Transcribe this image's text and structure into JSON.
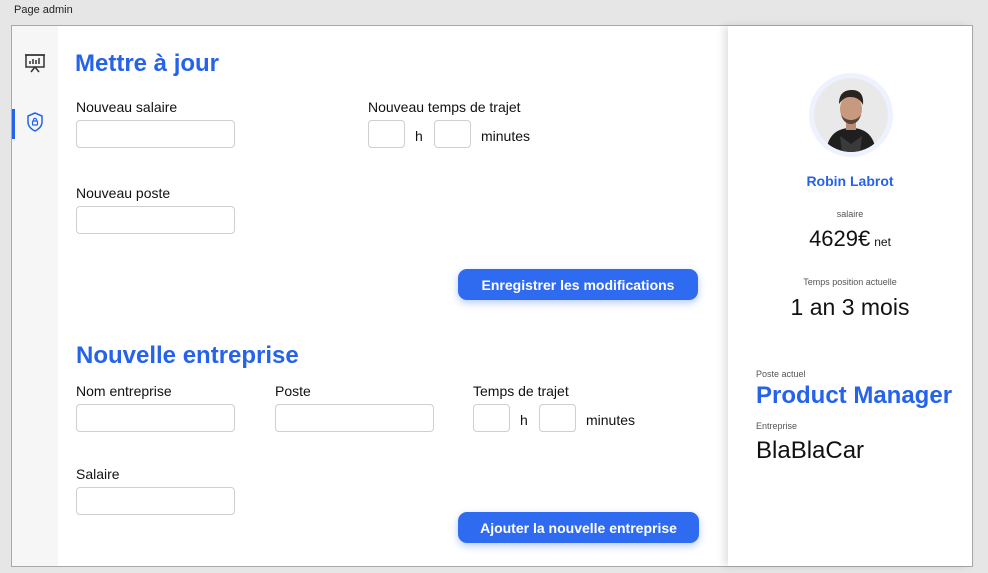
{
  "window": {
    "title": "Page admin"
  },
  "sidebar": {
    "items": [
      {
        "icon": "presentation-chart-icon",
        "active": false
      },
      {
        "icon": "shield-lock-icon",
        "active": true
      }
    ]
  },
  "update": {
    "heading": "Mettre à jour",
    "salary_label": "Nouveau salaire",
    "salary_value": "",
    "commute_label": "Nouveau temps de trajet",
    "commute_hours": "",
    "commute_minutes": "",
    "unit_h": "h",
    "unit_minutes": "minutes",
    "position_label": "Nouveau poste",
    "position_value": "",
    "save_button": "Enregistrer les modifications"
  },
  "new_company": {
    "heading": "Nouvelle entreprise",
    "company_label": "Nom entreprise",
    "company_value": "",
    "position_label": "Poste",
    "position_value": "",
    "commute_label": "Temps de trajet",
    "commute_hours": "",
    "commute_minutes": "",
    "unit_h": "h",
    "unit_minutes": "minutes",
    "salary_label": "Salaire",
    "salary_value": "",
    "add_button": "Ajouter la nouvelle entreprise"
  },
  "profile": {
    "name": "Robin Labrot",
    "salary_label": "salaire",
    "salary_value": "4629€",
    "salary_unit": "net",
    "tenure_label": "Temps position actuelle",
    "tenure_value": "1 an 3 mois",
    "current_position_label": "Poste actuel",
    "current_position": "Product Manager",
    "company_label": "Entreprise",
    "company": "BlaBlaCar"
  },
  "colors": {
    "accent": "#2563eb",
    "button": "#2f6bf1"
  }
}
